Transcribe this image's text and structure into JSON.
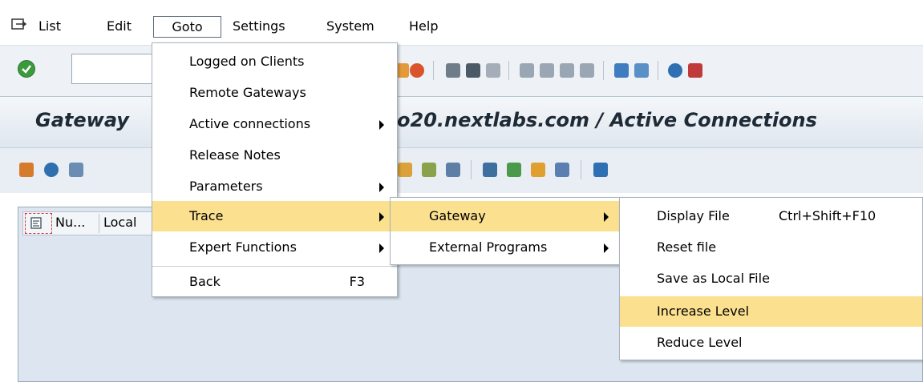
{
  "menubar": {
    "items": [
      {
        "label": "List"
      },
      {
        "label": "Edit"
      },
      {
        "label": "Goto"
      },
      {
        "label": "Settings"
      },
      {
        "label": "System"
      },
      {
        "label": "Help"
      }
    ]
  },
  "title": {
    "left": "Gateway ",
    "right": "o20.nextlabs.com / Active Connections"
  },
  "list": {
    "columns": [
      "Nu...",
      "Local"
    ]
  },
  "goto_menu": {
    "items": [
      {
        "label": "Logged on Clients"
      },
      {
        "label": "Remote Gateways"
      },
      {
        "label": "Active connections"
      },
      {
        "label": "Release Notes"
      },
      {
        "label": "Parameters"
      },
      {
        "label": "Trace"
      },
      {
        "label": "Expert Functions"
      },
      {
        "label": "Back",
        "shortcut": "F3"
      }
    ]
  },
  "trace_menu": {
    "items": [
      {
        "label": "Gateway"
      },
      {
        "label": "External Programs"
      }
    ]
  },
  "gateway_menu": {
    "items": [
      {
        "label": "Display File",
        "shortcut": "Ctrl+Shift+F10"
      },
      {
        "label": "Reset file"
      },
      {
        "label": "Save as Local File"
      },
      {
        "label": "Increase Level"
      },
      {
        "label": "Reduce Level"
      }
    ]
  },
  "colors": {
    "highlight": "#fbe08f",
    "list_background": "#dde6f0"
  }
}
